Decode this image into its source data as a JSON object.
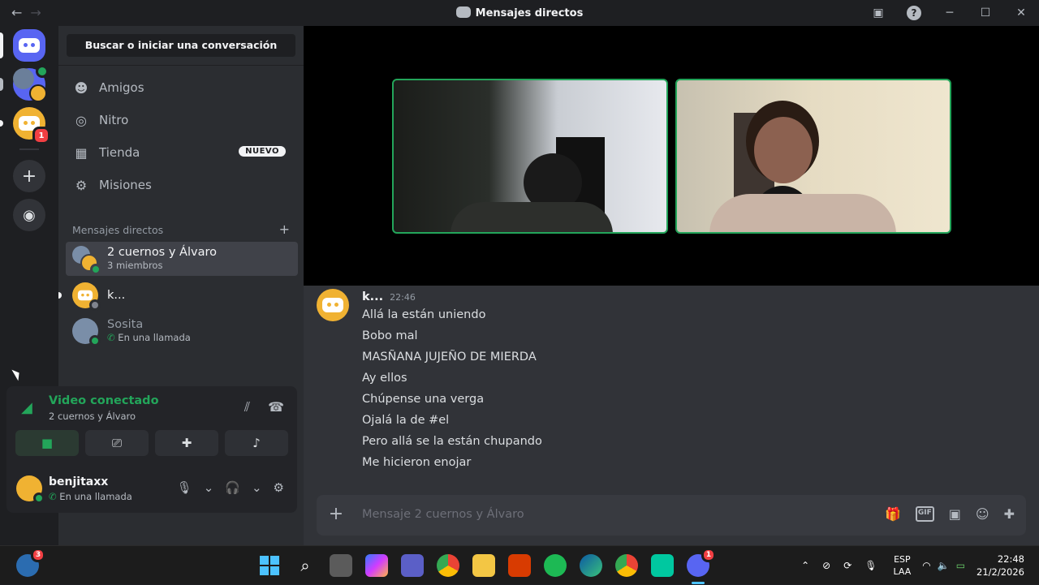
{
  "titlebar": {
    "title": "Mensajes directos"
  },
  "servers": {
    "dm_badge": "1"
  },
  "sidebar": {
    "search_label": "Buscar o iniciar una conversación",
    "nav": [
      {
        "label": "Amigos"
      },
      {
        "label": "Nitro"
      },
      {
        "label": "Tienda",
        "badge": "NUEVO"
      },
      {
        "label": "Misiones"
      }
    ],
    "dm_header": "Mensajes directos",
    "dms": [
      {
        "name": "2 cuernos y Álvaro",
        "sub": "3 miembros"
      },
      {
        "name": "k...",
        "sub": ""
      },
      {
        "name": "Sosita",
        "sub": "En una llamada"
      }
    ]
  },
  "voice": {
    "status": "Video conectado",
    "channel": "2 cuernos y Álvaro"
  },
  "user": {
    "name": "benjitaxx",
    "status": "En una llamada"
  },
  "chat": {
    "author": "k...",
    "time": "22:46",
    "lines": [
      "Allá la están uniendo",
      "Bobo mal",
      "MASÑANA JUJEÑO DE MIERDA",
      "Ay ellos",
      "Chúpense una verga",
      "Ojalá la de #el",
      "Pero allá se la están chupando",
      "Me hicieron enojar"
    ],
    "placeholder": "Mensaje 2 cuernos y Álvaro"
  },
  "taskbar": {
    "widgets_badge": "3",
    "discord_badge": "1",
    "lang_line1": "ESP",
    "lang_line2": "LAA",
    "time": "22:48",
    "date": "21/2/2026"
  },
  "colors": {
    "accent": "#5865f2",
    "online": "#23a55a",
    "yellow_avatar": "#f0b232"
  }
}
